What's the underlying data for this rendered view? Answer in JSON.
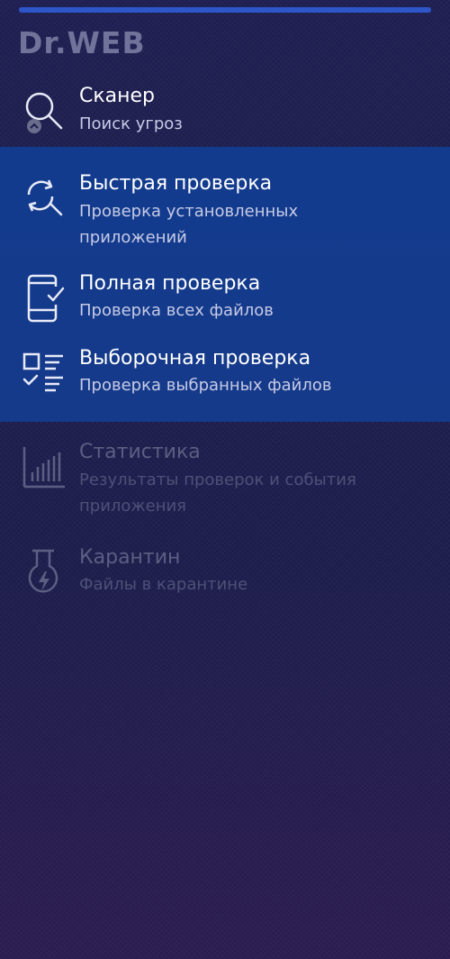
{
  "logo": "Dr.WEB",
  "progress": {
    "value": 1.0
  },
  "menu": {
    "scanner": {
      "title": "Сканер",
      "subtitle": "Поиск угроз",
      "icon": "search-icon"
    },
    "quick_scan": {
      "title": "Быстрая проверка",
      "subtitle_line1": "Проверка установленных",
      "subtitle_line2": "приложений",
      "icon": "refresh-search-icon"
    },
    "full_scan": {
      "title": "Полная проверка",
      "subtitle": "Проверка всех файлов",
      "icon": "phone-check-icon"
    },
    "custom_scan": {
      "title": "Выборочная проверка",
      "subtitle": "Проверка выбранных файлов",
      "icon": "checklist-icon"
    },
    "statistics": {
      "title": "Статистика",
      "subtitle_line1": "Результаты проверок и события",
      "subtitle_line2": "приложения",
      "icon": "bar-chart-icon"
    },
    "quarantine": {
      "title": "Карантин",
      "subtitle": "Файлы в карантине",
      "icon": "flask-icon"
    }
  },
  "colors": {
    "background": "#1d1e50",
    "highlight": "#123b8e",
    "text_primary": "#ffffff",
    "text_secondary": "#c7cbe6",
    "text_disabled": "#5b5f83"
  }
}
